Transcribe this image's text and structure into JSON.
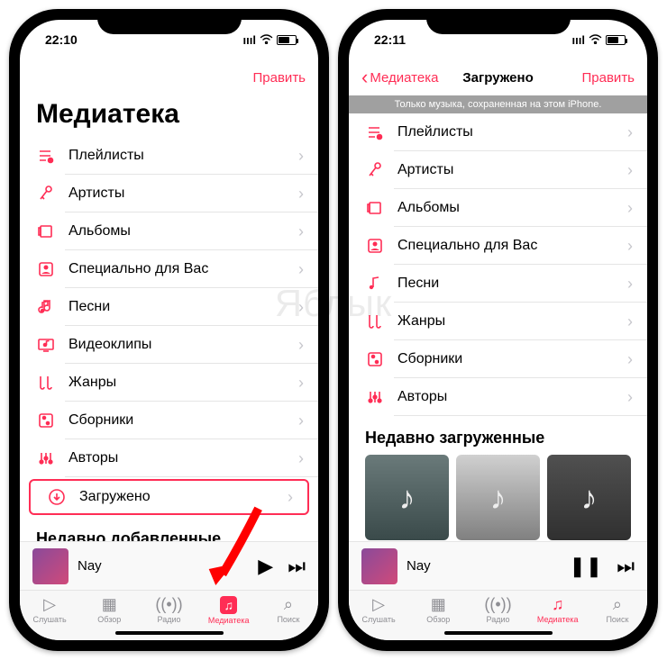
{
  "watermark": "Яблык",
  "phone1": {
    "time": "22:10",
    "edit": "Править",
    "large_title": "Медиатека",
    "rows": [
      {
        "label": "Плейлисты"
      },
      {
        "label": "Артисты"
      },
      {
        "label": "Альбомы"
      },
      {
        "label": "Специально для Вас"
      },
      {
        "label": "Песни"
      },
      {
        "label": "Видеоклипы"
      },
      {
        "label": "Жанры"
      },
      {
        "label": "Сборники"
      },
      {
        "label": "Авторы"
      },
      {
        "label": "Загружено"
      }
    ],
    "section": "Недавно добавленные",
    "nowplaying": "Nay",
    "tabs": [
      "Слушать",
      "Обзор",
      "Радио",
      "Медиатека",
      "Поиск"
    ]
  },
  "phone2": {
    "time": "22:11",
    "back": "Медиатека",
    "title": "Загружено",
    "edit": "Править",
    "banner": "Только музыка, сохраненная на этом iPhone.",
    "rows": [
      {
        "label": "Плейлисты"
      },
      {
        "label": "Артисты"
      },
      {
        "label": "Альбомы"
      },
      {
        "label": "Специально для Вас"
      },
      {
        "label": "Песни"
      },
      {
        "label": "Жанры"
      },
      {
        "label": "Сборники"
      },
      {
        "label": "Авторы"
      }
    ],
    "section": "Недавно загруженные",
    "nowplaying": "Nay",
    "tabs": [
      "Слушать",
      "Обзор",
      "Радио",
      "Медиатека",
      "Поиск"
    ]
  }
}
